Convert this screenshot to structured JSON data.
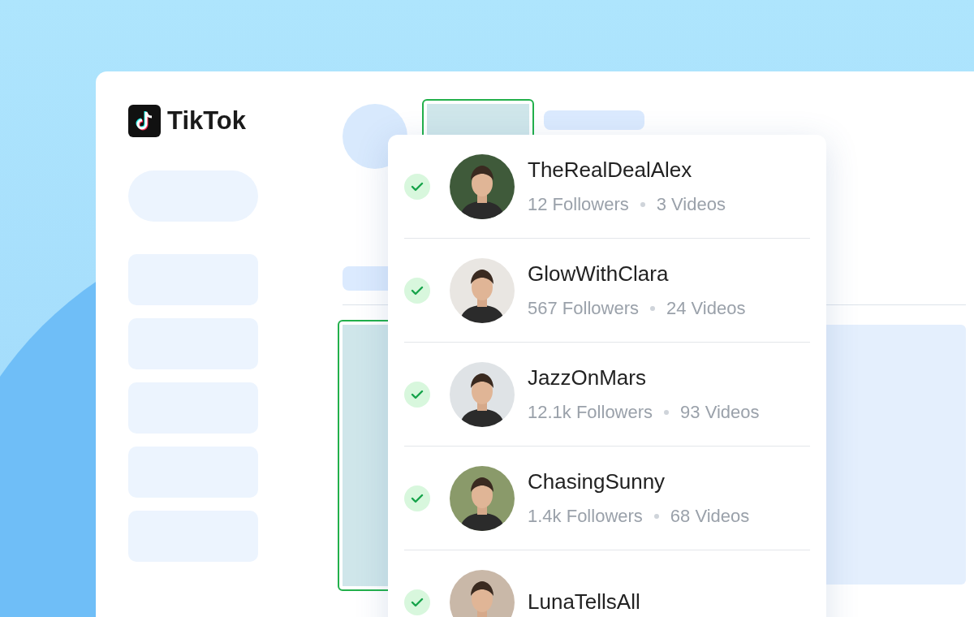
{
  "logo": {
    "text": "TikTok"
  },
  "accounts": [
    {
      "name": "TheRealDealAlex",
      "followers": "12 Followers",
      "videos": "3 Videos",
      "checked": true
    },
    {
      "name": "GlowWithClara",
      "followers": "567 Followers",
      "videos": "24 Videos",
      "checked": true
    },
    {
      "name": "JazzOnMars",
      "followers": "12.1k Followers",
      "videos": "93 Videos",
      "checked": true
    },
    {
      "name": "ChasingSunny",
      "followers": "1.4k Followers",
      "videos": "68 Videos",
      "checked": true
    },
    {
      "name": "LunaTellsAll",
      "checked": true
    }
  ]
}
